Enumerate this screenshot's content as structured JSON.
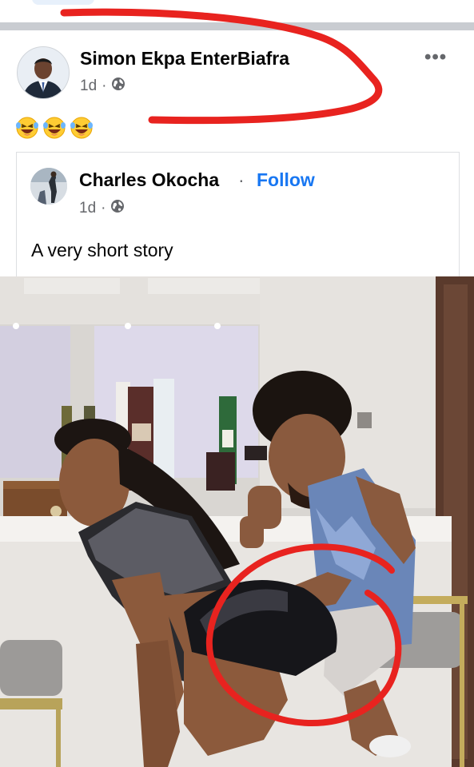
{
  "post": {
    "author": "Simon Ekpa EnterBiafra",
    "time": "1d",
    "separator": "·",
    "more_label": "•••",
    "reactions": [
      "laughing-crying-emoji",
      "laughing-crying-emoji",
      "laughing-crying-emoji"
    ]
  },
  "shared": {
    "author": "Charles Okocha",
    "separator": "·",
    "follow_label": "Follow",
    "time": "1d",
    "time_separator": "·",
    "caption": "A very short story"
  },
  "colors": {
    "link": "#1877f2",
    "secondary_text": "#65676b",
    "annotation": "#e8231f"
  },
  "icons": [
    "globe-icon",
    "more-options-icon"
  ]
}
